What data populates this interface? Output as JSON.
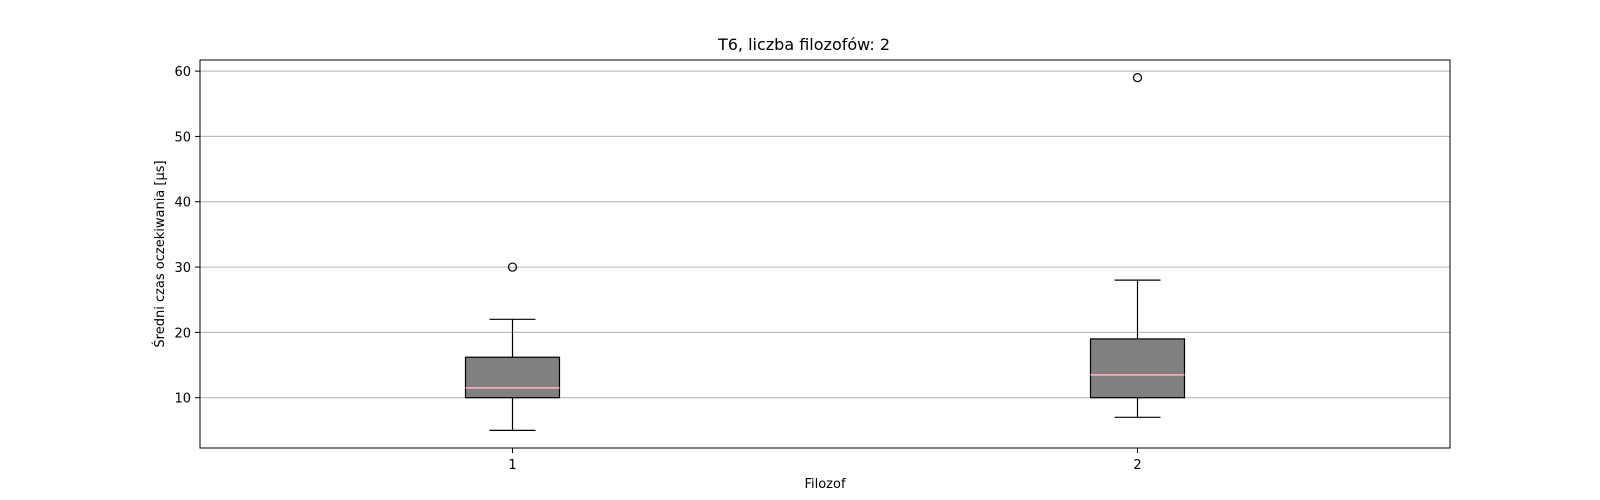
{
  "chart_data": {
    "type": "box",
    "title": "T6, liczba filozofów: 2",
    "xlabel": "Filozof",
    "ylabel": "Średni czas oczekiwania [µs]",
    "categories": [
      "1",
      "2"
    ],
    "ylim": [
      2.3,
      61.7
    ],
    "yticks": [
      10,
      20,
      30,
      40,
      50,
      60
    ],
    "grid": "y",
    "boxes": [
      {
        "category": "1",
        "whislo": 5,
        "q1": 10,
        "median": 11.5,
        "q3": 16.2,
        "whishi": 22,
        "outliers": [
          30
        ]
      },
      {
        "category": "2",
        "whislo": 7,
        "q1": 10,
        "median": 13.5,
        "q3": 19,
        "whishi": 28,
        "outliers": [
          59
        ]
      }
    ],
    "colors": {
      "box_fill": "#808080",
      "median": "#ffb6c1",
      "grid": "#b0b0b0",
      "edge": "#000000"
    }
  }
}
